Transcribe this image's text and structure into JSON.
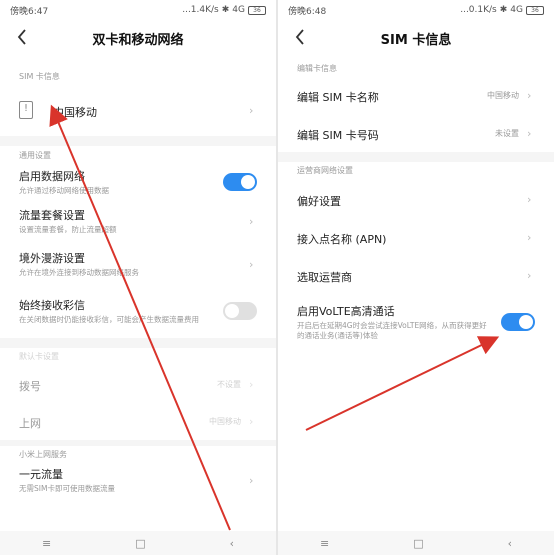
{
  "left": {
    "status": {
      "time": "傍晚6:47",
      "speed": "...1.4K/s",
      "network": "4G",
      "battery": "36"
    },
    "title": "双卡和移动网络",
    "sim_section": "SIM 卡信息",
    "sim_name": "中国移动",
    "general_section": "通用设置",
    "data_network": {
      "label": "启用数据网络",
      "sub": "允许通过移动网络使用数据"
    },
    "traffic_plan": {
      "label": "流量套餐设置",
      "sub": "设置流量套餐，防止流量超额"
    },
    "roaming": {
      "label": "境外漫游设置",
      "sub": "允许在境外连接到移动数据网络服务"
    },
    "mms": {
      "label": "始终接收彩信",
      "sub": "在关闭数据时仍能接收彩信，可能会产生数据流量费用"
    },
    "default_section": "默认卡设置",
    "dial": {
      "label": "拨号",
      "value": "不设置"
    },
    "internet": {
      "label": "上网",
      "value": "中国移动"
    },
    "mi_section": "小米上网服务",
    "yiyuan": {
      "label": "一元流量",
      "sub": "无需SIM卡即可使用数据流量"
    }
  },
  "right": {
    "status": {
      "time": "傍晚6:48",
      "speed": "...0.1K/s",
      "network": "4G",
      "battery": "36"
    },
    "title": "SIM 卡信息",
    "edit_section": "编辑卡信息",
    "edit_name": {
      "label": "编辑 SIM 卡名称",
      "value": "中国移动"
    },
    "edit_number": {
      "label": "编辑 SIM 卡号码",
      "value": "未设置"
    },
    "carrier_section": "运营商网络设置",
    "preferred": {
      "label": "偏好设置"
    },
    "apn": {
      "label": "接入点名称 (APN)"
    },
    "carrier": {
      "label": "选取运营商"
    },
    "volte": {
      "label": "启用VoLTE高清通话",
      "sub": "开启后在延期4G时会尝试连接VoLTE网络，从而获得更好的通话业务(通话等)体验"
    }
  },
  "colors": {
    "accent": "#2d8cf0",
    "arrow": "#d9342b"
  }
}
